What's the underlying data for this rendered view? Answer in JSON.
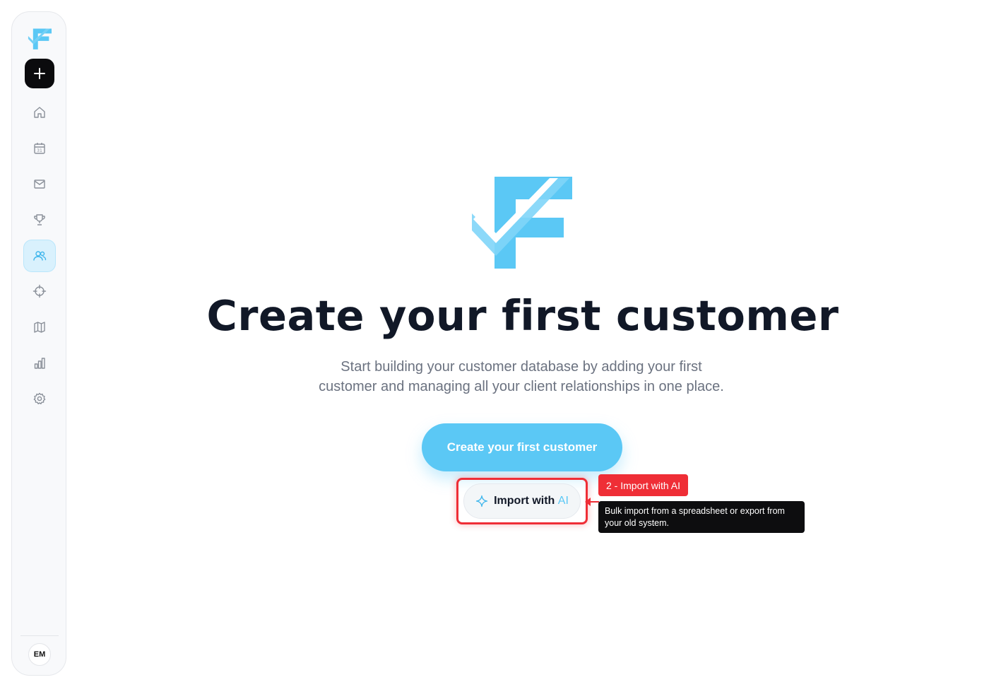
{
  "sidebar": {
    "logo_icon": "brand-f-check-logo",
    "new_button_icon": "plus-icon",
    "items": [
      {
        "id": "home",
        "icon": "home-icon"
      },
      {
        "id": "calendar",
        "icon": "calendar-icon"
      },
      {
        "id": "mail",
        "icon": "mail-icon"
      },
      {
        "id": "deals",
        "icon": "trophy-icon"
      },
      {
        "id": "customers",
        "icon": "users-icon",
        "active": true
      },
      {
        "id": "leads",
        "icon": "crosshair-icon"
      },
      {
        "id": "map",
        "icon": "map-icon"
      },
      {
        "id": "reports",
        "icon": "bar-chart-icon"
      },
      {
        "id": "settings",
        "icon": "gear-icon"
      }
    ],
    "avatar_initials": "EM"
  },
  "main": {
    "title": "Create your first customer",
    "subtitle_line1": "Start building your customer database by adding your first",
    "subtitle_line2": "customer and managing all your client relationships in one place.",
    "primary_button_label": "Create your first customer",
    "import_button": {
      "label": "Import with",
      "ai_label": "AI",
      "icon": "sparkle-icon"
    }
  },
  "walkthrough": {
    "step_label": "2 - Import with AI",
    "tooltip_line1": "Bulk import from a spreadsheet or export from",
    "tooltip_line2": "your old system."
  },
  "colors": {
    "accent": "#5bc8f5",
    "accent_light": "#d9f1fd",
    "highlight_red": "#ef2e36",
    "title_text": "#111827",
    "subtitle_text": "#6b7280",
    "tooltip_bg": "#0d0d0f"
  }
}
